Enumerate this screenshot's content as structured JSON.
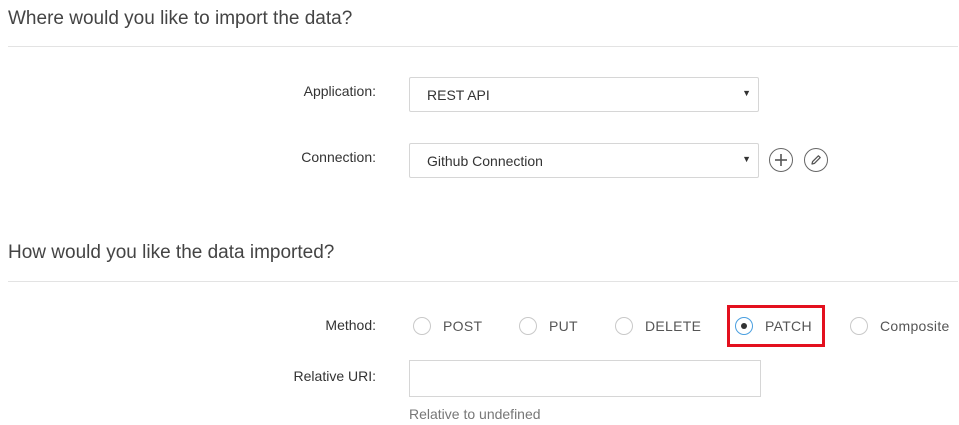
{
  "import_section": {
    "title": "Where would you like to import the data?"
  },
  "application": {
    "label": "Application:",
    "value": "REST API"
  },
  "connection": {
    "label": "Connection:",
    "value": "Github Connection"
  },
  "method_section": {
    "title": "How would you like the data imported?"
  },
  "method": {
    "label": "Method:",
    "options": [
      "POST",
      "PUT",
      "DELETE",
      "PATCH",
      "Composite"
    ],
    "selected": "PATCH"
  },
  "relative_uri": {
    "label": "Relative URI:",
    "value": "",
    "helper": "Relative to undefined"
  },
  "colors": {
    "highlight": "#e3101e",
    "radio_selected": "#4a9fe0"
  },
  "icons": {
    "add_connection": "plus-circle-icon",
    "edit_connection": "pencil-circle-icon",
    "dropdown": "caret-down-icon"
  }
}
